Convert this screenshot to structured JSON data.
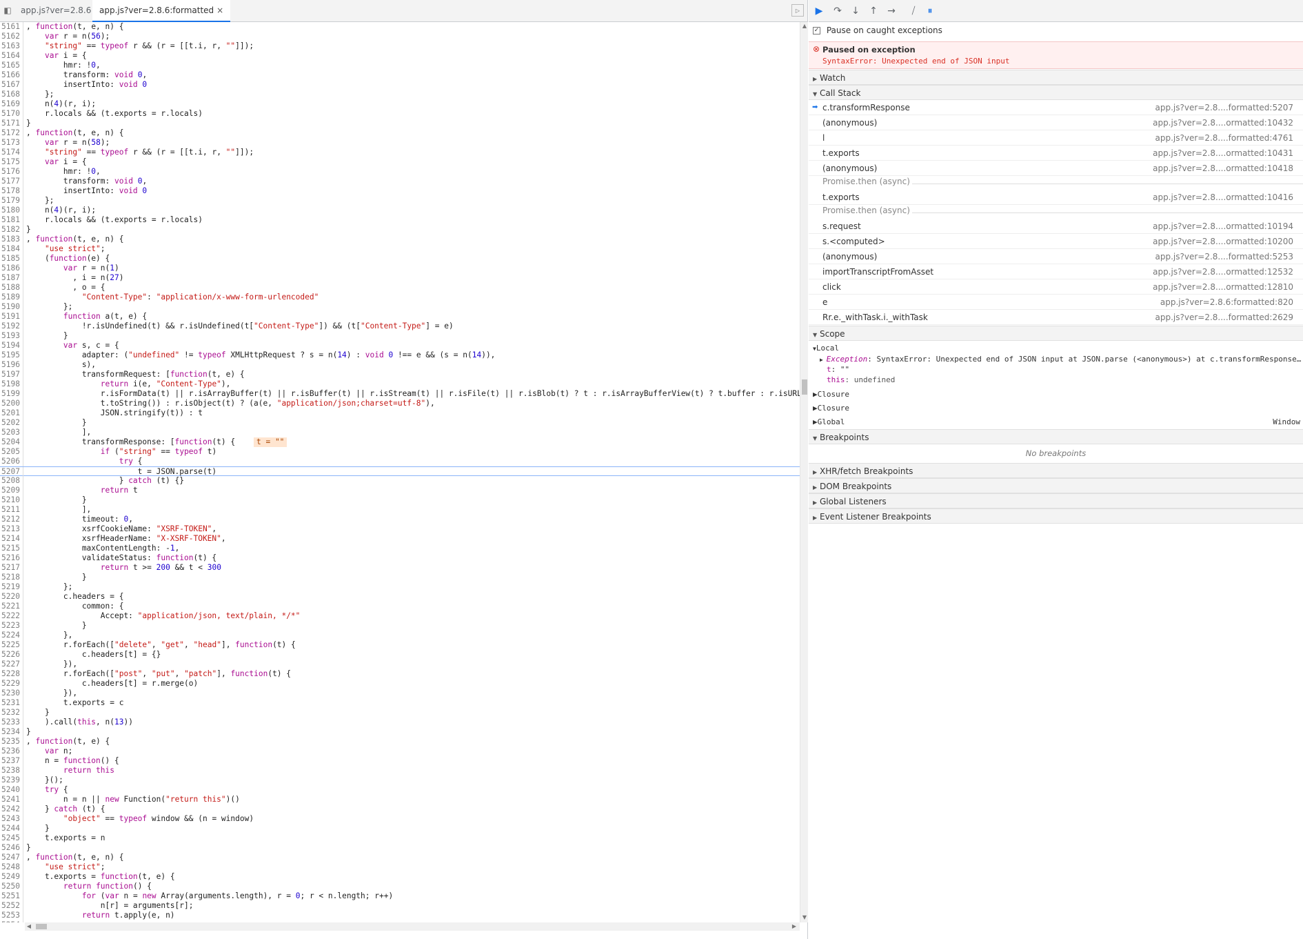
{
  "tabs": [
    {
      "label": "app.js?ver=2.8.6"
    },
    {
      "label": "app.js?ver=2.8.6:formatted",
      "close": "×"
    }
  ],
  "toolbar_icons": [
    "navigator-toggle-icon",
    "resume-icon",
    "step-over-icon",
    "step-into-icon",
    "step-out-icon",
    "step-icon",
    "deactivate-breakpoints-icon",
    "pause-on-exceptions-icon"
  ],
  "code": {
    "current_line": "5207",
    "inline_value": "t = \"\"",
    "lines": [
      {
        "n": "5161",
        "t": ", function(t, e, n) {"
      },
      {
        "n": "5162",
        "t": "    var r = n(56);"
      },
      {
        "n": "5163",
        "t": "    \"string\" == typeof r && (r = [[t.i, r, \"\"]]);"
      },
      {
        "n": "5164",
        "t": "    var i = {"
      },
      {
        "n": "5165",
        "t": "        hmr: !0,"
      },
      {
        "n": "5166",
        "t": "        transform: void 0,"
      },
      {
        "n": "5167",
        "t": "        insertInto: void 0"
      },
      {
        "n": "5168",
        "t": "    };"
      },
      {
        "n": "5169",
        "t": "    n(4)(r, i);"
      },
      {
        "n": "5170",
        "t": "    r.locals && (t.exports = r.locals)"
      },
      {
        "n": "5171",
        "t": "}"
      },
      {
        "n": "5172",
        "t": ", function(t, e, n) {"
      },
      {
        "n": "5173",
        "t": "    var r = n(58);"
      },
      {
        "n": "5174",
        "t": "    \"string\" == typeof r && (r = [[t.i, r, \"\"]]);"
      },
      {
        "n": "5175",
        "t": "    var i = {"
      },
      {
        "n": "5176",
        "t": "        hmr: !0,"
      },
      {
        "n": "5177",
        "t": "        transform: void 0,"
      },
      {
        "n": "5178",
        "t": "        insertInto: void 0"
      },
      {
        "n": "5179",
        "t": "    };"
      },
      {
        "n": "5180",
        "t": "    n(4)(r, i);"
      },
      {
        "n": "5181",
        "t": "    r.locals && (t.exports = r.locals)"
      },
      {
        "n": "5182",
        "t": "}"
      },
      {
        "n": "5183",
        "t": ", function(t, e, n) {"
      },
      {
        "n": "5184",
        "t": "    \"use strict\";"
      },
      {
        "n": "5185",
        "t": "    (function(e) {"
      },
      {
        "n": "5186",
        "t": "        var r = n(1)"
      },
      {
        "n": "5187",
        "t": "          , i = n(27)"
      },
      {
        "n": "5188",
        "t": "          , o = {"
      },
      {
        "n": "5189",
        "t": "            \"Content-Type\": \"application/x-www-form-urlencoded\""
      },
      {
        "n": "5190",
        "t": "        };"
      },
      {
        "n": "5191",
        "t": "        function a(t, e) {"
      },
      {
        "n": "5192",
        "t": "            !r.isUndefined(t) && r.isUndefined(t[\"Content-Type\"]) && (t[\"Content-Type\"] = e)"
      },
      {
        "n": "5193",
        "t": "        }"
      },
      {
        "n": "5194",
        "t": "        var s, c = {"
      },
      {
        "n": "5195",
        "t": "            adapter: (\"undefined\" != typeof XMLHttpRequest ? s = n(14) : void 0 !== e && (s = n(14)),"
      },
      {
        "n": "5196",
        "t": "            s),"
      },
      {
        "n": "5197",
        "t": "            transformRequest: [function(t, e) {"
      },
      {
        "n": "5198",
        "t": "                return i(e, \"Content-Type\"),"
      },
      {
        "n": "5199",
        "t": "                r.isFormData(t) || r.isArrayBuffer(t) || r.isBuffer(t) || r.isStream(t) || r.isFile(t) || r.isBlob(t) ? t : r.isArrayBufferView(t) ? t.buffer : r.isURLSe"
      },
      {
        "n": "5200",
        "t": "                t.toString()) : r.isObject(t) ? (a(e, \"application/json;charset=utf-8\"),"
      },
      {
        "n": "5201",
        "t": "                JSON.stringify(t)) : t"
      },
      {
        "n": "5202",
        "t": "            }"
      },
      {
        "n": "5203",
        "t": "            ],"
      },
      {
        "n": "5204",
        "t": "            transformResponse: [function(t) {"
      },
      {
        "n": "5205",
        "t": "                if (\"string\" == typeof t)"
      },
      {
        "n": "5206",
        "t": "                    try {"
      },
      {
        "n": "5207",
        "t": "                        t = JSON.parse(t)"
      },
      {
        "n": "5208",
        "t": "                    } catch (t) {}"
      },
      {
        "n": "5209",
        "t": "                return t"
      },
      {
        "n": "5210",
        "t": "            }"
      },
      {
        "n": "5211",
        "t": "            ],"
      },
      {
        "n": "5212",
        "t": "            timeout: 0,"
      },
      {
        "n": "5213",
        "t": "            xsrfCookieName: \"XSRF-TOKEN\","
      },
      {
        "n": "5214",
        "t": "            xsrfHeaderName: \"X-XSRF-TOKEN\","
      },
      {
        "n": "5215",
        "t": "            maxContentLength: -1,"
      },
      {
        "n": "5216",
        "t": "            validateStatus: function(t) {"
      },
      {
        "n": "5217",
        "t": "                return t >= 200 && t < 300"
      },
      {
        "n": "5218",
        "t": "            }"
      },
      {
        "n": "5219",
        "t": "        };"
      },
      {
        "n": "5220",
        "t": "        c.headers = {"
      },
      {
        "n": "5221",
        "t": "            common: {"
      },
      {
        "n": "5222",
        "t": "                Accept: \"application/json, text/plain, */*\""
      },
      {
        "n": "5223",
        "t": "            }"
      },
      {
        "n": "5224",
        "t": "        },"
      },
      {
        "n": "5225",
        "t": "        r.forEach([\"delete\", \"get\", \"head\"], function(t) {"
      },
      {
        "n": "5226",
        "t": "            c.headers[t] = {}"
      },
      {
        "n": "5227",
        "t": "        }),"
      },
      {
        "n": "5228",
        "t": "        r.forEach([\"post\", \"put\", \"patch\"], function(t) {"
      },
      {
        "n": "5229",
        "t": "            c.headers[t] = r.merge(o)"
      },
      {
        "n": "5230",
        "t": "        }),"
      },
      {
        "n": "5231",
        "t": "        t.exports = c"
      },
      {
        "n": "5232",
        "t": "    }"
      },
      {
        "n": "5233",
        "t": "    ).call(this, n(13))"
      },
      {
        "n": "5234",
        "t": "}"
      },
      {
        "n": "5235",
        "t": ", function(t, e) {"
      },
      {
        "n": "5236",
        "t": "    var n;"
      },
      {
        "n": "5237",
        "t": "    n = function() {"
      },
      {
        "n": "5238",
        "t": "        return this"
      },
      {
        "n": "5239",
        "t": "    }();"
      },
      {
        "n": "5240",
        "t": "    try {"
      },
      {
        "n": "5241",
        "t": "        n = n || new Function(\"return this\")()"
      },
      {
        "n": "5242",
        "t": "    } catch (t) {"
      },
      {
        "n": "5243",
        "t": "        \"object\" == typeof window && (n = window)"
      },
      {
        "n": "5244",
        "t": "    }"
      },
      {
        "n": "5245",
        "t": "    t.exports = n"
      },
      {
        "n": "5246",
        "t": "}"
      },
      {
        "n": "5247",
        "t": ", function(t, e, n) {"
      },
      {
        "n": "5248",
        "t": "    \"use strict\";"
      },
      {
        "n": "5249",
        "t": "    t.exports = function(t, e) {"
      },
      {
        "n": "5250",
        "t": "        return function() {"
      },
      {
        "n": "5251",
        "t": "            for (var n = new Array(arguments.length), r = 0; r < n.length; r++)"
      },
      {
        "n": "5252",
        "t": "                n[r] = arguments[r];"
      },
      {
        "n": "5253",
        "t": "            return t.apply(e, n)"
      },
      {
        "n": "5254",
        "t": ""
      }
    ]
  },
  "sidebar": {
    "pause_on_caught_label": "Pause on caught exceptions",
    "paused_title": "Paused on exception",
    "paused_error": "SyntaxError: Unexpected end of JSON input",
    "watch_label": "Watch",
    "call_stack_label": "Call Stack",
    "call_stack": [
      {
        "fn": "c.transformResponse",
        "loc": "app.js?ver=2.8....formatted:5207"
      },
      {
        "fn": "(anonymous)",
        "loc": "app.js?ver=2.8....ormatted:10432"
      },
      {
        "fn": "l",
        "loc": "app.js?ver=2.8....formatted:4761"
      },
      {
        "fn": "t.exports",
        "loc": "app.js?ver=2.8....ormatted:10431"
      },
      {
        "fn": "(anonymous)",
        "loc": "app.js?ver=2.8....ormatted:10418"
      },
      {
        "fn": "Promise.then (async)",
        "loc": "",
        "async": true
      },
      {
        "fn": "t.exports",
        "loc": "app.js?ver=2.8....ormatted:10416"
      },
      {
        "fn": "Promise.then (async)",
        "loc": "",
        "async": true
      },
      {
        "fn": "s.request",
        "loc": "app.js?ver=2.8....ormatted:10194"
      },
      {
        "fn": "s.<computed>",
        "loc": "app.js?ver=2.8....ormatted:10200"
      },
      {
        "fn": "(anonymous)",
        "loc": "app.js?ver=2.8....formatted:5253"
      },
      {
        "fn": "importTranscriptFromAsset",
        "loc": "app.js?ver=2.8....ormatted:12532"
      },
      {
        "fn": "click",
        "loc": "app.js?ver=2.8....ormatted:12810"
      },
      {
        "fn": "e",
        "loc": "app.js?ver=2.8.6:formatted:820"
      },
      {
        "fn": "Rr.e._withTask.i._withTask",
        "loc": "app.js?ver=2.8....formatted:2629"
      }
    ],
    "scope_label": "Scope",
    "local_label": "Local",
    "exception_key": "Exception",
    "exception_value": ": SyntaxError: Unexpected end of JSON input at JSON.parse (<anonymous>) at c.transformResponse…",
    "t_key": "t",
    "t_value": ": \"\"",
    "this_key": "this",
    "this_value": ": undefined",
    "closure1": "Closure",
    "closure2": "Closure",
    "global_label": "Global",
    "global_value": "Window",
    "breakpoints_label": "Breakpoints",
    "no_breakpoints": "No breakpoints",
    "xhr_label": "XHR/fetch Breakpoints",
    "dom_label": "DOM Breakpoints",
    "global_listeners_label": "Global Listeners",
    "event_listener_label": "Event Listener Breakpoints"
  },
  "colors": {
    "accent": "#1a73e8",
    "error": "#d93025",
    "error_bg": "#fff0f0",
    "keyword": "#aa0d91",
    "string": "#c41a16",
    "number": "#1c00cf"
  }
}
